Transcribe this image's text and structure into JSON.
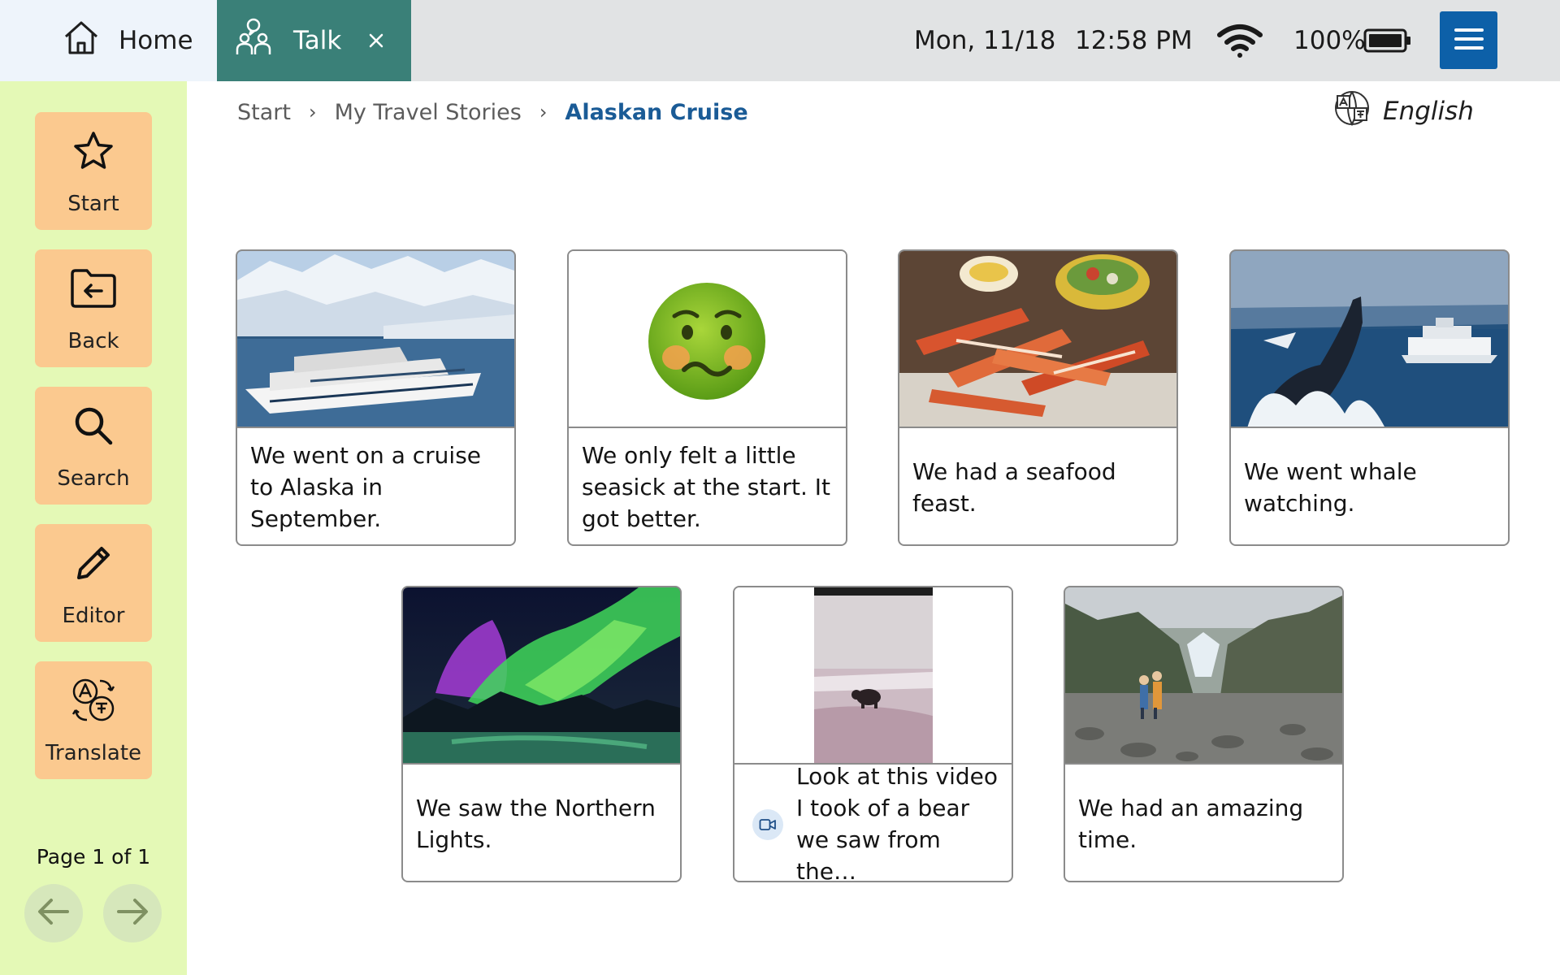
{
  "tabs": {
    "home_label": "Home",
    "talk_label": "Talk",
    "home_icon": "house-icon",
    "talk_icon": "people-talking-icon",
    "close_icon": "close-icon"
  },
  "status": {
    "date": "Mon,  11/18",
    "time": "12:58 PM",
    "battery": "100%",
    "wifi_icon": "wifi-icon",
    "battery_icon": "battery-icon",
    "menu_icon": "hamburger-menu-icon"
  },
  "sidebar": {
    "items": [
      {
        "label": "Start",
        "icon": "star-icon"
      },
      {
        "label": "Back",
        "icon": "folder-back-icon"
      },
      {
        "label": "Search",
        "icon": "search-icon"
      },
      {
        "label": "Editor",
        "icon": "pencil-icon"
      },
      {
        "label": "Translate",
        "icon": "translate-icon"
      }
    ],
    "page_label": "Page 1 of 1",
    "prev_icon": "arrow-left-icon",
    "next_icon": "arrow-right-icon"
  },
  "breadcrumb": {
    "items": [
      "Start",
      "My Travel Stories"
    ],
    "current": "Alaskan Cruise"
  },
  "language": {
    "label": "English",
    "icon": "language-icon"
  },
  "cards": [
    {
      "caption": "We went on a cruise to Alaska in September.",
      "image": "cruise-ship-glacier-image"
    },
    {
      "caption": "We only felt a little seasick at the start. It got better.",
      "image": "nauseated-face-emoji"
    },
    {
      "caption": "We had a seafood feast.",
      "image": "crab-legs-feast-image"
    },
    {
      "caption": "We went whale watching.",
      "image": "whale-breaching-image"
    },
    {
      "caption": "We saw the Northern Lights.",
      "image": "northern-lights-image"
    },
    {
      "caption": "Look at this video I took of a bear we saw from the…",
      "image": "bear-video-thumbnail",
      "badge_icon": "video-icon"
    },
    {
      "caption": "We had an amazing time.",
      "image": "hikers-valley-image"
    }
  ],
  "colors": {
    "accent_blue": "#0d60a8",
    "talk_tab": "#3a8078",
    "sidebar_bg": "#e4f9b6",
    "sidebar_button": "#fbc98f"
  }
}
